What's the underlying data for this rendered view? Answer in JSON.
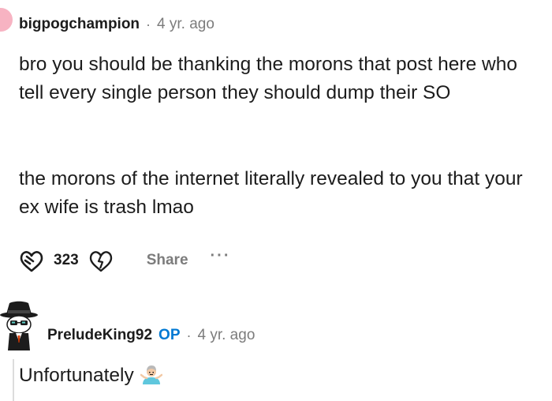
{
  "comment": {
    "username": "bigpogchampion",
    "separator": "·",
    "time": "4 yr. ago",
    "paragraphs": [
      "bro you should be thanking the morons that post here who tell every single person they should dump their SO",
      "the morons of the internet literally revealed to you that your ex wife is trash lmao"
    ],
    "score": "323",
    "share_label": "Share",
    "more_label": "···",
    "avatar_color": "#f7b3c2"
  },
  "reply": {
    "username": "PreludeKing92",
    "op_badge": "OP",
    "separator": "·",
    "time": "4 yr. ago",
    "text": "Unfortunately",
    "emoji_icon": "person-shrugging-emoji"
  },
  "colors": {
    "text": "#1c1c1c",
    "meta": "#7c7c7c",
    "op_badge": "#0079d3",
    "thread_line": "#dcdcdc"
  }
}
